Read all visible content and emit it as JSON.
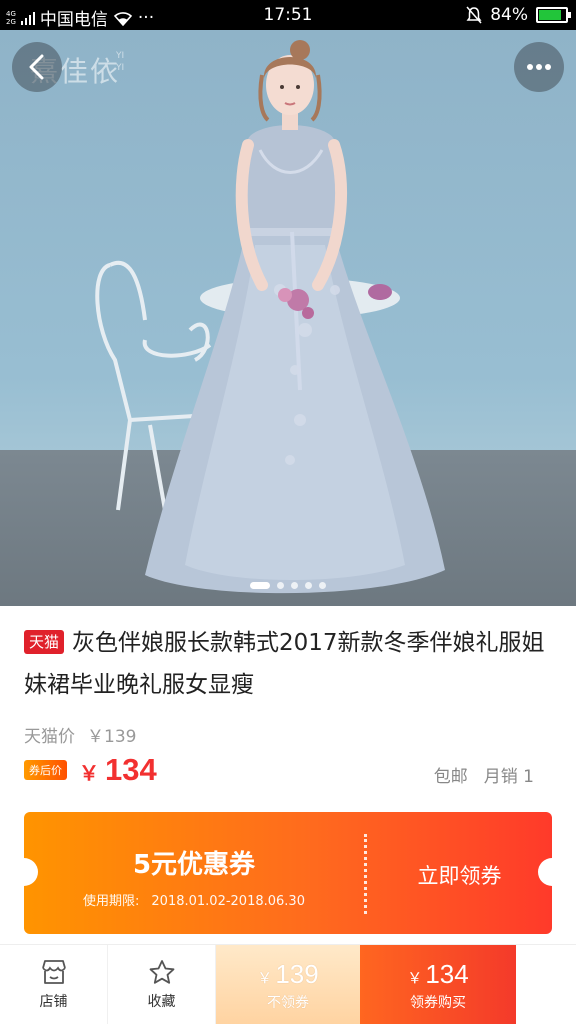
{
  "status_bar": {
    "network_top": "4G",
    "network_bottom": "2G",
    "carrier": "中国电信",
    "more": "···",
    "time": "17:51",
    "battery": "84%",
    "battery_level": 0.84,
    "battery_color": "#22c53a"
  },
  "hero": {
    "brand_logo": "熹佳依",
    "brand_logo_sub_top": "YI",
    "brand_logo_sub_bottom": "YI",
    "slide_count": 5,
    "active_slide": 1
  },
  "product": {
    "tmall_badge": "天猫",
    "title": "灰色伴娘服长款韩式2017新款冬季伴娘礼服姐妹裙毕业晚礼服女显瘦",
    "orig_price_label": "天猫价",
    "orig_price": "￥139",
    "after_coupon_badge": "券后价",
    "currency": "￥",
    "after_coupon_price": "134",
    "shipping": "包邮",
    "monthly_sales": "月销 1"
  },
  "coupon": {
    "title": "5元优惠券",
    "validity_label": "使用期限:",
    "validity_range": "2018.01.02-2018.06.30",
    "claim_label": "立即领券"
  },
  "bottom_bar": {
    "shop_label": "店铺",
    "favorite_label": "收藏",
    "currency": "￥",
    "plain_price": "139",
    "plain_label": "不领券",
    "coupon_price": "134",
    "coupon_label": "领券购买"
  },
  "colors": {
    "accent_red": "#f23030",
    "tmall_red": "#e0212b",
    "coupon_orange": "#ff9400"
  }
}
